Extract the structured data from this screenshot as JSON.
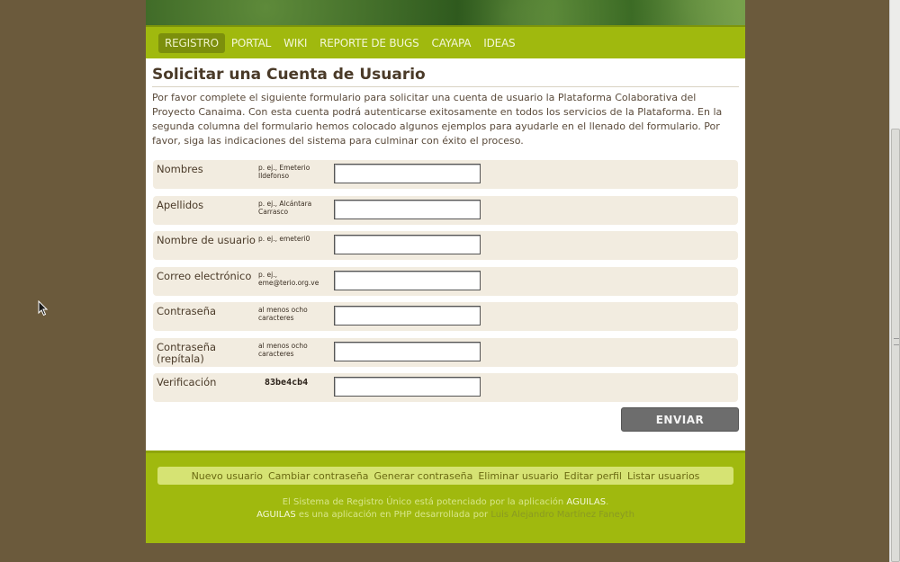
{
  "nav": {
    "items": [
      {
        "label": "REGISTRO"
      },
      {
        "label": "PORTAL"
      },
      {
        "label": "WIKI"
      },
      {
        "label": "REPORTE DE BUGS"
      },
      {
        "label": "CAYAPA"
      },
      {
        "label": "IDEAS"
      }
    ],
    "active": "REGISTRO"
  },
  "form": {
    "title": "Solicitar una Cuenta de Usuario",
    "intro": "Por favor complete el siguiente formulario para solicitar una cuenta de usuario la Plataforma Colaborativa del Proyecto Canaima. Con esta cuenta podrá autenticarse exitosamente en todos los servicios de la Plataforma. En la segunda columna del formulario hemos colocado algunos ejemplos para ayudarle en el llenado del formulario. Por favor, siga las indicaciones del sistema para culminar con éxito el proceso.",
    "fields": [
      {
        "label": "Nombres",
        "hint": "p. ej., Emeterio Ildefonso",
        "value": ""
      },
      {
        "label": "Apellidos",
        "hint": "p. ej., Alcántara Carrasco",
        "value": ""
      },
      {
        "label": "Nombre de usuario",
        "hint": "p. ej., emeteri0",
        "value": ""
      },
      {
        "label": "Correo electrónico",
        "hint": "p. ej., eme@terio.org.ve",
        "value": ""
      },
      {
        "label": "Contraseña",
        "hint": "al menos ocho caracteres",
        "value": ""
      },
      {
        "label": "Contraseña (repítala)",
        "hint": "al menos ocho caracteres",
        "value": ""
      },
      {
        "label": "Verificación",
        "hint": "83be4cb4",
        "value": ""
      }
    ],
    "submit_label": "ENVIAR"
  },
  "footer": {
    "links": [
      {
        "label": "Nuevo usuario"
      },
      {
        "label": "Cambiar contraseña"
      },
      {
        "label": "Generar contraseña"
      },
      {
        "label": "Eliminar usuario"
      },
      {
        "label": "Editar perfil"
      },
      {
        "label": "Listar usuarios"
      }
    ],
    "credits_line1_prefix": "El Sistema de Registro Único está potenciado por la aplicación",
    "credits_app": "AGUILAS",
    "credits_line1_suffix": ".",
    "credits_line2_app": "AGUILAS",
    "credits_line2_mid": "es una aplicación en PHP desarrollada por",
    "credits_author": "Luis Alejandro Martínez Faneyth"
  },
  "colors": {
    "background": "#6b5a3c",
    "accent": "#a0b90e",
    "row_bg": "#f2ece0",
    "button": "#6d6d6d"
  },
  "icons": {
    "cursor": "mouse-pointer-icon",
    "scroll_grip": "scroll-grip-icon"
  }
}
